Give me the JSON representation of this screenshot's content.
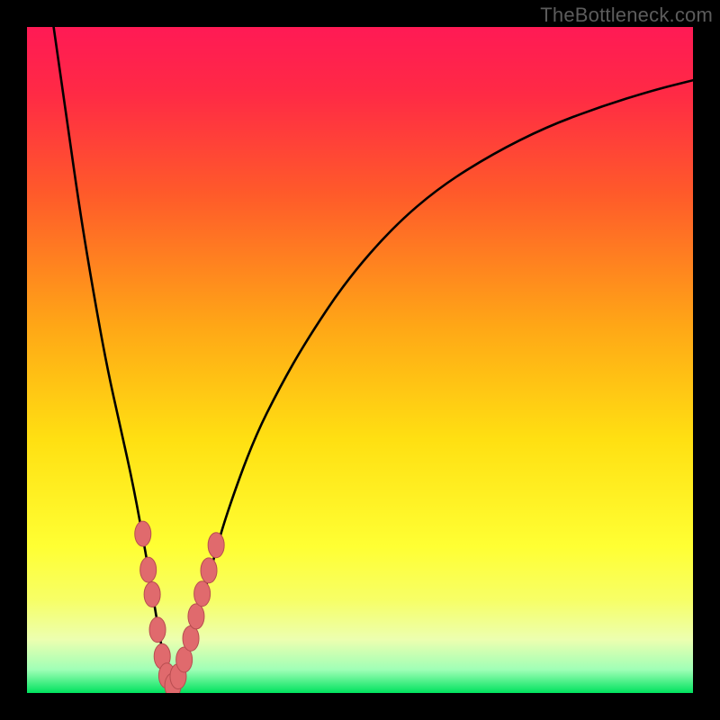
{
  "watermark": "TheBottleneck.com",
  "colors": {
    "frame": "#000000",
    "gradient_stops": [
      {
        "offset": 0.0,
        "color": "#ff1a55"
      },
      {
        "offset": 0.1,
        "color": "#ff2a45"
      },
      {
        "offset": 0.25,
        "color": "#ff5a2a"
      },
      {
        "offset": 0.45,
        "color": "#ffa716"
      },
      {
        "offset": 0.62,
        "color": "#ffe012"
      },
      {
        "offset": 0.78,
        "color": "#ffff33"
      },
      {
        "offset": 0.86,
        "color": "#f7ff66"
      },
      {
        "offset": 0.92,
        "color": "#ecffb0"
      },
      {
        "offset": 0.965,
        "color": "#9fffb6"
      },
      {
        "offset": 1.0,
        "color": "#00e25e"
      }
    ],
    "curve": "#000000",
    "marker_fill": "#e06a6d",
    "marker_stroke": "#b84d50"
  },
  "chart_data": {
    "type": "line",
    "title": "",
    "xlabel": "",
    "ylabel": "",
    "xlim": [
      0,
      100
    ],
    "ylim": [
      0,
      100
    ],
    "grid": false,
    "legend": false,
    "series": [
      {
        "name": "bottleneck-curve",
        "x": [
          4,
          6,
          8,
          10,
          12,
          14,
          16,
          18,
          19,
          20,
          21,
          22,
          23,
          24,
          26,
          28,
          30,
          34,
          38,
          42,
          48,
          55,
          62,
          70,
          78,
          86,
          94,
          100
        ],
        "y": [
          100,
          86,
          72,
          60,
          49,
          40,
          31,
          20,
          14,
          8,
          3,
          1,
          2,
          6,
          13,
          20,
          27,
          38,
          46,
          53,
          62,
          70,
          76,
          81,
          85,
          88,
          90.5,
          92
        ]
      }
    ],
    "markers": {
      "name": "highlighted-region",
      "points": [
        {
          "x": 17.4,
          "y": 23.9
        },
        {
          "x": 18.2,
          "y": 18.5
        },
        {
          "x": 18.8,
          "y": 14.8
        },
        {
          "x": 19.6,
          "y": 9.5
        },
        {
          "x": 20.3,
          "y": 5.5
        },
        {
          "x": 21.0,
          "y": 2.6
        },
        {
          "x": 21.9,
          "y": 1.1
        },
        {
          "x": 22.7,
          "y": 2.5
        },
        {
          "x": 23.6,
          "y": 5.0
        },
        {
          "x": 24.6,
          "y": 8.2
        },
        {
          "x": 25.4,
          "y": 11.5
        },
        {
          "x": 26.3,
          "y": 14.9
        },
        {
          "x": 27.3,
          "y": 18.4
        },
        {
          "x": 28.4,
          "y": 22.2
        }
      ]
    }
  }
}
